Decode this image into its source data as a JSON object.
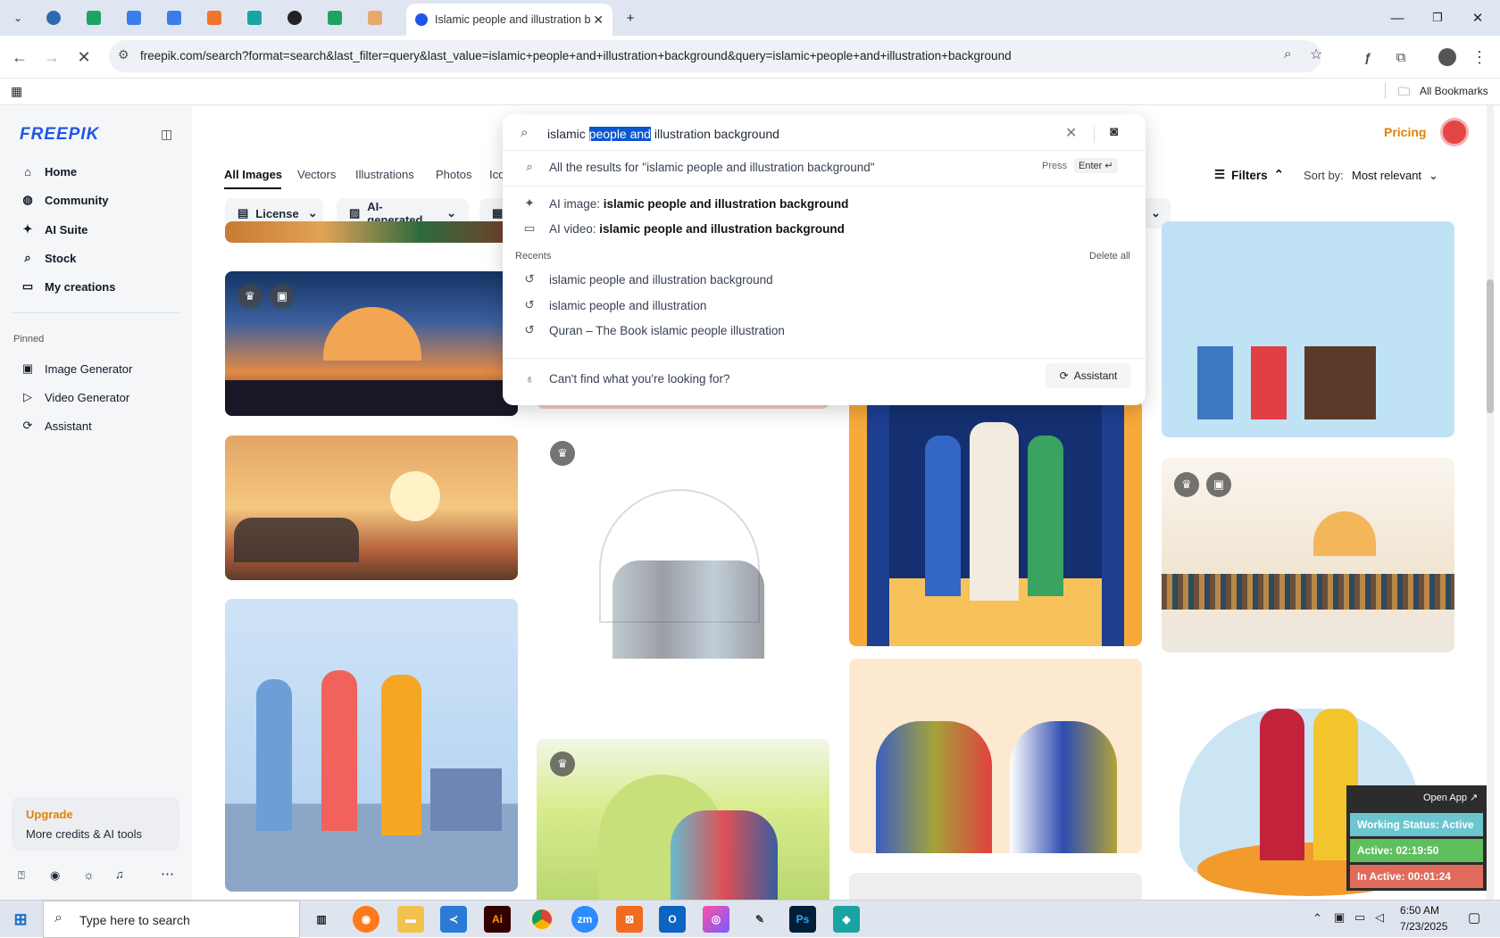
{
  "browser": {
    "active_tab_title": "Islamic people and illustration b",
    "url": "freepik.com/search?format=search&last_filter=query&last_value=islamic+people+and+illustration+background&query=islamic+people+and+illustration+background",
    "bookmarks_label": "All Bookmarks",
    "tab_icons": [
      "chevron-down-icon",
      "wordpress-icon",
      "sheets-icon",
      "docs-icon",
      "docs-icon",
      "frame-icon",
      "app-icon",
      "openai-icon",
      "sheets-icon",
      "studio-icon"
    ]
  },
  "header": {
    "logo": "FREEPIK",
    "pricing_label": "Pricing"
  },
  "sidebar": {
    "items": [
      {
        "label": "Home",
        "icon": "home-icon"
      },
      {
        "label": "Community",
        "icon": "globe-icon"
      },
      {
        "label": "AI Suite",
        "icon": "sparkle-icon"
      },
      {
        "label": "Stock",
        "icon": "search-icon"
      },
      {
        "label": "My creations",
        "icon": "folder-icon"
      }
    ],
    "pinned_label": "Pinned",
    "pinned": [
      {
        "label": "Image Generator",
        "icon": "image-icon"
      },
      {
        "label": "Video Generator",
        "icon": "video-icon"
      },
      {
        "label": "Assistant",
        "icon": "assistant-icon"
      }
    ],
    "upgrade_title": "Upgrade",
    "upgrade_sub": "More credits & AI tools"
  },
  "filters": {
    "tabs": [
      "All Images",
      "Vectors",
      "Illustrations",
      "Photos",
      "Ico"
    ],
    "chips": [
      "License",
      "AI-generated"
    ],
    "filters_label": "Filters",
    "sort_label": "Sort by:",
    "sort_value": "Most relevant"
  },
  "search": {
    "query_before": "islamic ",
    "query_selected": "people and",
    "query_after": " illustration background",
    "all_results": "All the results for \"islamic people and illustration background\"",
    "press_label": "Press",
    "enter_label": "Enter ↵",
    "ai_image_prefix": "AI image:",
    "ai_image_query": "islamic people and illustration background",
    "ai_video_prefix": "AI video:",
    "ai_video_query": "islamic people and illustration background",
    "recents_label": "Recents",
    "delete_all": "Delete all",
    "recents": [
      "islamic people and illustration background",
      "islamic people and illustration",
      "Quran – The Book islamic people illustration"
    ],
    "cant_find": "Can't find what you're looking for?",
    "assistant_label": "Assistant"
  },
  "status_widget": {
    "open_app": "Open App ↗",
    "working": "Working Status: Active",
    "active": "Active: 02:19:50",
    "inactive": "In Active: 00:01:24"
  },
  "taskbar": {
    "search_placeholder": "Type here to search",
    "time": "6:50 AM",
    "date": "7/23/2025"
  },
  "colors": {
    "brand": "#1e56e8",
    "pricing": "#e0820a",
    "selection": "#0b57d0",
    "status_working": "#6cc6cf",
    "status_active": "#5fbf5f",
    "status_inactive": "#e06b5c"
  }
}
